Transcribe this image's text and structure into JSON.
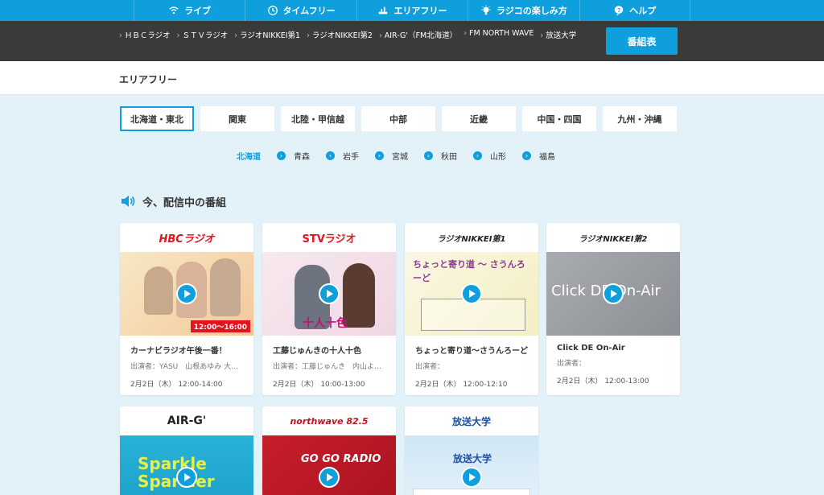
{
  "nav": [
    {
      "label": "ライブ",
      "icon": "wifi-icon"
    },
    {
      "label": "タイムフリー",
      "icon": "clock-icon"
    },
    {
      "label": "エリアフリー",
      "icon": "location-icon"
    },
    {
      "label": "ラジコの楽しみ方",
      "icon": "lightbulb-icon"
    },
    {
      "label": "ヘルプ",
      "icon": "help-icon"
    }
  ],
  "stations": [
    "ＨＢＣラジオ",
    "ＳＴＶラジオ",
    "ラジオNIKKEI第1",
    "ラジオNIKKEI第2",
    "AIR-G'（FM北海道）",
    "FM NORTH WAVE",
    "放送大学"
  ],
  "bangumi_label": "番組表",
  "page_title": "エリアフリー",
  "regions": [
    {
      "label": "北海道・東北",
      "active": true
    },
    {
      "label": "関東"
    },
    {
      "label": "北陸・甲信越"
    },
    {
      "label": "中部"
    },
    {
      "label": "近畿"
    },
    {
      "label": "中国・四国"
    },
    {
      "label": "九州・沖縄"
    }
  ],
  "prefectures": [
    "北海道",
    "青森",
    "岩手",
    "宮城",
    "秋田",
    "山形",
    "福島"
  ],
  "section_title": "今、配信中の番組",
  "programs": [
    {
      "logo": "HBCラジオ",
      "title": "カーナビラジオ午後一番！",
      "cast": "出演者：YASU　山根あゆみ 大…",
      "time": "2月2日（木）  12:00-14:00",
      "thumb_text": "12:00〜16:00",
      "colors": [
        "#f3c89a",
        "#f7e8c4"
      ],
      "logo_color": "#e4141e"
    },
    {
      "logo": "STVラジオ",
      "title": "工藤じゅんきの十人十色",
      "cast": "出演者：工藤じゅんき　内山よ…",
      "time": "2月2日（木）  10:00-13:00",
      "thumb_text": "十人十色",
      "colors": [
        "#f0d6e4",
        "#f7e9ee"
      ],
      "logo_color": "#e4141e"
    },
    {
      "logo": "ラジオNIKKEI第1",
      "title": "ちょっと寄り道〜さうんろーど",
      "cast": "出演者：",
      "time": "2月2日（木）  12:00-12:10",
      "thumb_text": "ちょっと寄り道 〜 さうんろーど",
      "colors": [
        "#f4eec2",
        "#fbf7e3"
      ],
      "logo_color": "#222"
    },
    {
      "logo": "ラジオNIKKEI第2",
      "title": "Click DE On-Air",
      "cast": "出演者：",
      "time": "2月2日（木）  12:00-13:00",
      "thumb_text": "Click DE On-Air",
      "colors": [
        "#8b8f93",
        "#a8acb0"
      ],
      "logo_color": "#222"
    },
    {
      "logo": "AIR-G'",
      "thumb_text": "Sparkle Sparkler",
      "colors": [
        "#28b2d8",
        "#1c9ec8"
      ],
      "logo_color": "#222"
    },
    {
      "logo": "northwave 82.5",
      "thumb_text": "GO GO RADIO",
      "colors": [
        "#c71e2b",
        "#a8141f"
      ],
      "logo_color": "#c4121c"
    },
    {
      "logo": "放送大学",
      "thumb_text": "放送大学",
      "colors": [
        "#cfe6f6",
        "#e9f4fb"
      ],
      "logo_color": "#1b4fa0"
    }
  ]
}
